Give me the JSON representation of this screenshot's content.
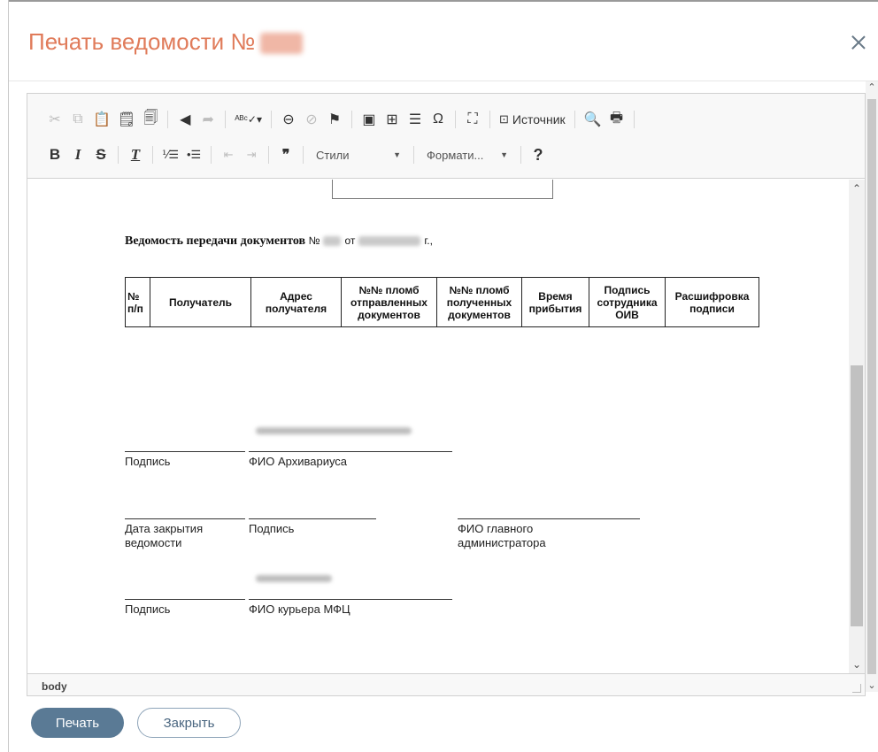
{
  "dialog": {
    "title": "Печать ведомости №",
    "close_label": "×"
  },
  "toolbar": {
    "source_label": "Источник",
    "styles_label": "Стили",
    "format_label": "Формати...",
    "help_label": "?",
    "bold_label": "B",
    "italic_label": "I",
    "strike_label": "S",
    "clear_format_label": "T",
    "quote_label": "❞❞",
    "special_char_label": "Ω"
  },
  "document": {
    "heading_bold": "Ведомость передачи документов",
    "heading_no": "№",
    "heading_from": "от",
    "heading_year": "г.,",
    "table_headers": [
      "№ п/п",
      "Получатель",
      "Адрес получателя",
      "№№ пломб отправленных документов",
      "№№ пломб полученных документов",
      "Время прибытия",
      "Подпись сотрудника ОИВ",
      "Расшифровка подписи"
    ],
    "sig_block1": {
      "label_left": "Подпись",
      "label_right": "ФИО Архивариуса"
    },
    "sig_block2": {
      "label_left": "Дата закрытия ведомости",
      "label_mid": "Подпись",
      "label_right": "ФИО главного администратора"
    },
    "sig_block3": {
      "label_left": "Подпись",
      "label_right": "ФИО курьера МФЦ"
    }
  },
  "statusbar": {
    "path": "body"
  },
  "footer": {
    "print_label": "Печать",
    "close_label": "Закрыть"
  }
}
